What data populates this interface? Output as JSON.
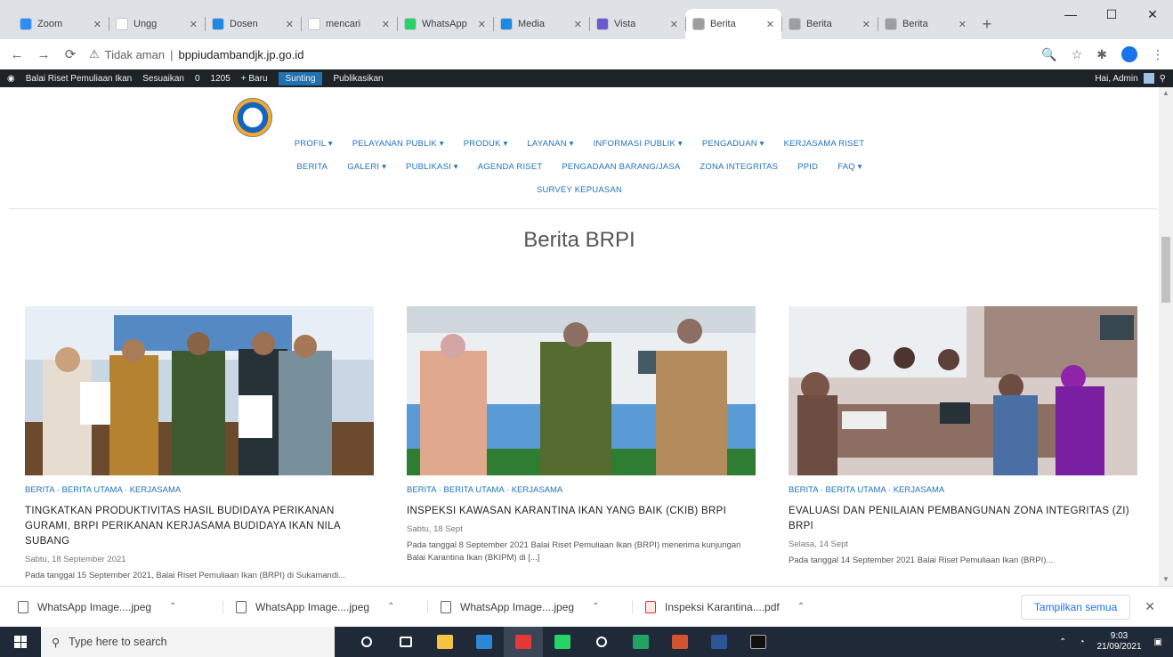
{
  "browser": {
    "tabs": [
      {
        "title": "Zoom",
        "favicon_color": "#2d8cff",
        "active": false
      },
      {
        "title": "Ungg",
        "favicon_color": "#ffffff",
        "active": false
      },
      {
        "title": "Dosen",
        "favicon_color": "#1e88e5",
        "active": false
      },
      {
        "title": "mencari",
        "favicon_color": "#ffffff",
        "active": false
      },
      {
        "title": "WhatsApp",
        "favicon_color": "#25d366",
        "active": false
      },
      {
        "title": "Media",
        "favicon_color": "#1e88e5",
        "active": false
      },
      {
        "title": "Vista",
        "favicon_color": "#6a5acd",
        "active": false
      },
      {
        "title": "Berita",
        "favicon_color": "#9e9e9e",
        "active": true
      },
      {
        "title": "Berita",
        "favicon_color": "#9e9e9e",
        "active": false
      },
      {
        "title": "Berita",
        "favicon_color": "#9e9e9e",
        "active": false
      }
    ],
    "tab_close": "✕",
    "new_tab": "+",
    "window_controls": {
      "minimize": "—",
      "maximize": "☐",
      "close": "✕"
    },
    "nav": {
      "back": "←",
      "forward": "→",
      "reload": "⟳"
    },
    "security_label": "Tidak aman",
    "host": "bppiudambandjk.jp.go.id",
    "toolbar_icons": {
      "zoom": "🔍",
      "star": "☆",
      "extensions": "✱"
    }
  },
  "adminbar": {
    "items": [
      "Balai Riset Pemuliaan Ikan",
      "Sesuaikan",
      "0",
      "0",
      "1205",
      "+ Baru",
      "Sunting",
      "Publikasikan"
    ],
    "new_label": "Sunting",
    "greeting": "Hai, Admin"
  },
  "header": {
    "nav_row1": [
      "Profil ▾",
      "Pelayanan Publik ▾",
      "Produk ▾",
      "Layanan ▾",
      "Informasi Publik ▾",
      "Pengaduan ▾",
      "Kerjasama Riset"
    ],
    "nav_row2": [
      "Berita",
      "Galeri ▾",
      "Publikasi ▾",
      "Agenda Riset",
      "Pengadaan Barang/Jasa",
      "Zona Integritas",
      "PPID",
      "FAQ ▾"
    ],
    "nav_row3": [
      "Survey Kepuasan"
    ]
  },
  "section_title": "Berita BRPI",
  "posts": [
    {
      "category": "Berita · Berita Utama · Kerjasama",
      "title": "Tingkatkan Produktivitas Hasil Budidaya Perikanan Gurami, BRPI Perikanan Kerjasama Budidaya Ikan Nila Subang",
      "date": "Sabtu, 18 September 2021",
      "excerpt": "Pada tanggal 15 September 2021, Balai Riset Pemuliaan Ikan (BRPI) di Sukamandi..."
    },
    {
      "category": "Berita · Berita Utama · Kerjasama",
      "title": "Inspeksi Kawasan Karantina Ikan yang Baik (CKIB) BRPI",
      "date": "Sabtu, 18 Sept",
      "excerpt": "Pada tanggal 8 September 2021 Balai Riset Pemuliaan Ikan (BRPI) menerima kunjungan Balai Karantina Ikan (BKIPM) di [...]"
    },
    {
      "category": "Berita · Berita Utama · Kerjasama",
      "title": "Evaluasi dan Penilaian Pembangunan Zona Integritas (ZI) BRPI",
      "date": "Selasa, 14 Sept",
      "excerpt": "Pada tanggal 14 September 2021 Balai Riset Pemuliaan Ikan (BRPI)..."
    }
  ],
  "downloads": {
    "items": [
      {
        "name": "WhatsApp Image....jpeg",
        "type": "image"
      },
      {
        "name": "WhatsApp Image....jpeg",
        "type": "image"
      },
      {
        "name": "WhatsApp Image....jpeg",
        "type": "image"
      },
      {
        "name": "Inspeksi Karantina....pdf",
        "type": "pdf"
      }
    ],
    "show_all": "Tampilkan semua",
    "close": "✕",
    "caret": "⌃"
  },
  "taskbar": {
    "search_placeholder": "Type here to search",
    "icons": [
      {
        "name": "cortana",
        "color": "#ffffff"
      },
      {
        "name": "task-view",
        "color": "#ffffff"
      },
      {
        "name": "file-explorer",
        "color": "#f4c542"
      },
      {
        "name": "store",
        "color": "#2b88d8"
      },
      {
        "name": "chrome",
        "color": "#e53935"
      },
      {
        "name": "whatsapp",
        "color": "#25d366"
      },
      {
        "name": "search-app",
        "color": "#ffffff"
      },
      {
        "name": "excel",
        "color": "#21a366"
      },
      {
        "name": "powerpoint",
        "color": "#d35230"
      },
      {
        "name": "word",
        "color": "#2b579a"
      },
      {
        "name": "terminal",
        "color": "#111111"
      }
    ],
    "time": "9:03",
    "date": "21/09/2021"
  },
  "colors": {
    "link": "#1e73be",
    "admin_bar": "#1d2327",
    "taskbar": "#1f2937"
  }
}
